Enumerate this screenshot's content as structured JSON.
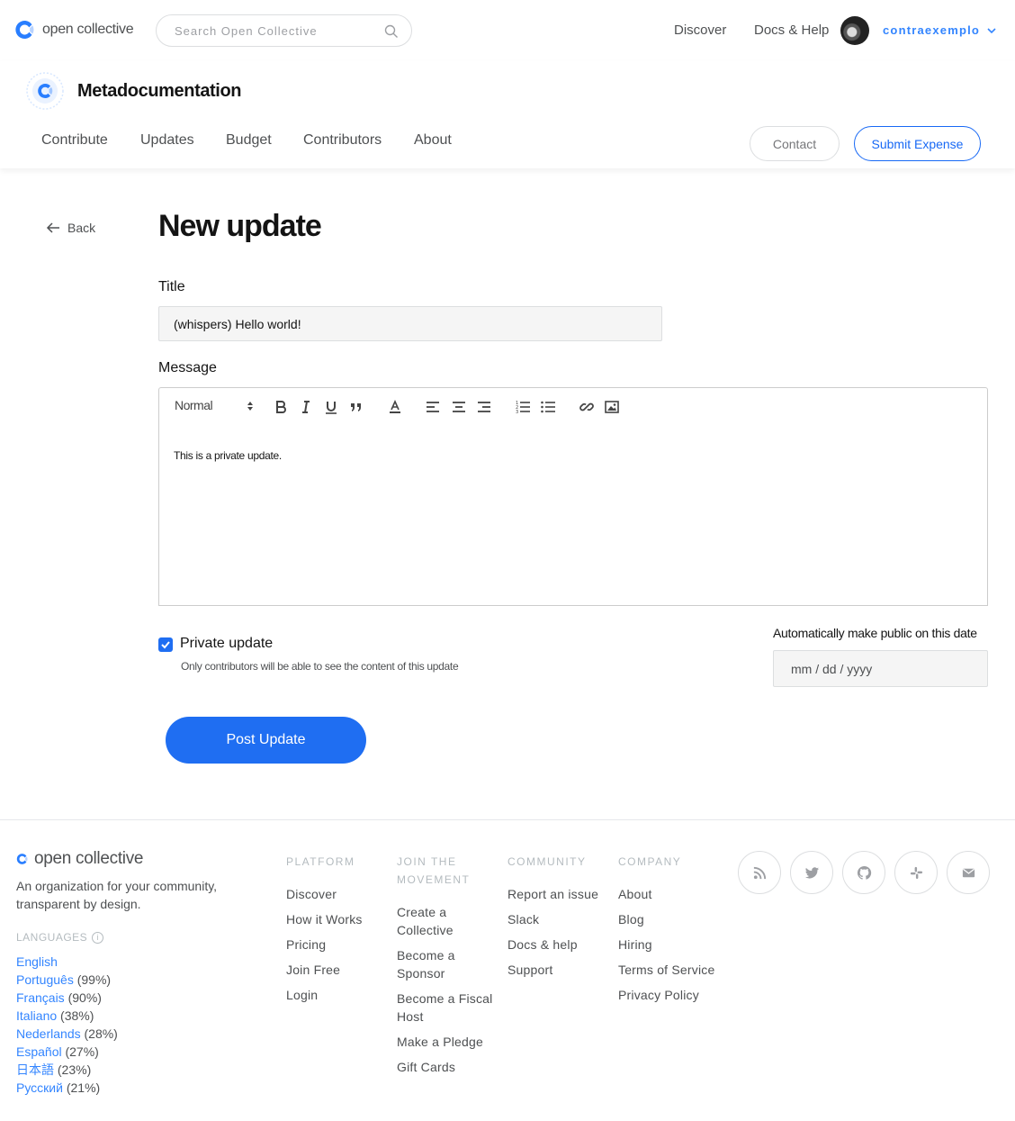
{
  "topbar": {
    "logo_text": "open collective",
    "search_placeholder": "Search Open Collective",
    "nav": {
      "discover": "Discover",
      "docs": "Docs & Help"
    },
    "username": "contraexemplo"
  },
  "collective": {
    "name": "Metadocumentation",
    "tabs": [
      "Contribute",
      "Updates",
      "Budget",
      "Contributors",
      "About"
    ],
    "contact_label": "Contact",
    "submit_expense_label": "Submit Expense"
  },
  "main": {
    "back_label": "Back",
    "title": "New update",
    "title_label": "Title",
    "title_value": "(whispers) Hello world!",
    "message_label": "Message",
    "heading_select": "Normal",
    "editor_text": "This is a private update.",
    "private_label": "Private update",
    "private_checked": true,
    "private_help": "Only contributors will be able to see the content of this update",
    "date_label": "Automatically make public on this date",
    "date_placeholder": "mm / dd / yyyy",
    "post_label": "Post Update"
  },
  "footer": {
    "logo_text": "open collective",
    "tagline": "An organization for your community, transparent by design.",
    "languages_heading": "LANGUAGES",
    "languages": [
      {
        "name": "English",
        "pct": ""
      },
      {
        "name": "Português",
        "pct": "(99%)"
      },
      {
        "name": "Français",
        "pct": "(90%)"
      },
      {
        "name": "Italiano",
        "pct": "(38%)"
      },
      {
        "name": "Nederlands",
        "pct": "(28%)"
      },
      {
        "name": "Español",
        "pct": "(27%)"
      },
      {
        "name": "日本語",
        "pct": "(23%)"
      },
      {
        "name": "Русский",
        "pct": "(21%)"
      }
    ],
    "columns": [
      {
        "heading": "PLATFORM",
        "links": [
          "Discover",
          "How it Works",
          "Pricing",
          "Join Free",
          "Login"
        ]
      },
      {
        "heading": "JOIN THE MOVEMENT",
        "links": [
          "Create a Collective",
          "Become a Sponsor",
          "Become a Fiscal Host",
          "Make a Pledge",
          "Gift Cards"
        ]
      },
      {
        "heading": "COMMUNITY",
        "links": [
          "Report an issue",
          "Slack",
          "Docs & help",
          "Support"
        ]
      },
      {
        "heading": "COMPANY",
        "links": [
          "About",
          "Blog",
          "Hiring",
          "Terms of Service",
          "Privacy Policy"
        ]
      }
    ],
    "social_icons": [
      "rss-icon",
      "twitter-icon",
      "github-icon",
      "slack-icon",
      "mail-icon"
    ]
  },
  "colors": {
    "primary": "#1f6ef2",
    "link": "#3385ff",
    "text": "#4e5052"
  }
}
